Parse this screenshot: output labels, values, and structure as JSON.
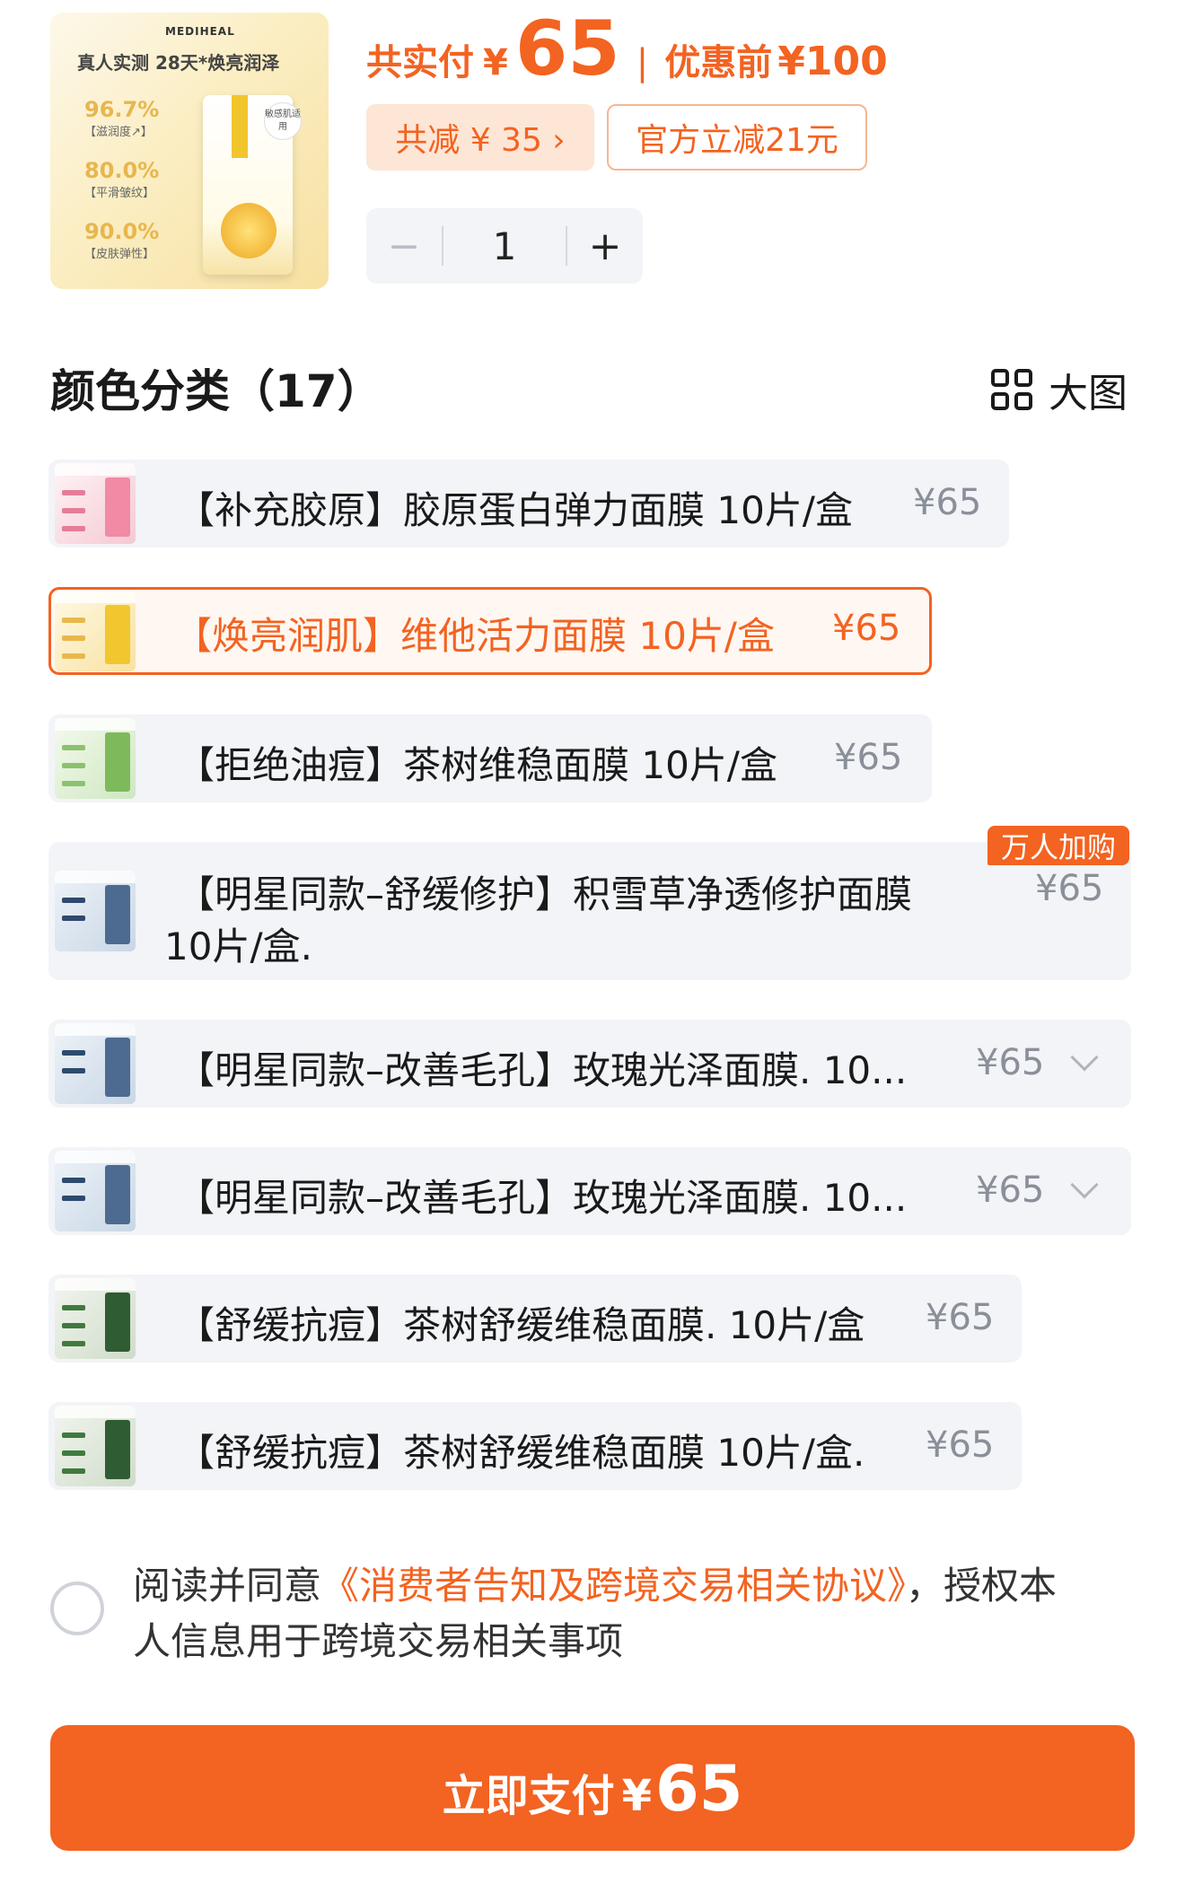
{
  "product": {
    "thumb_brand": "MEDIHEAL",
    "thumb_title": "真人实测  28天*焕亮润泽",
    "thumb_stats": [
      {
        "value": "96.7%",
        "label": "【滋润度↗】"
      },
      {
        "value": "80.0%",
        "label": "【平滑皱纹】"
      },
      {
        "value": "90.0%",
        "label": "【皮肤弹性】"
      }
    ],
    "thumb_badge": "敏感肌适用"
  },
  "price": {
    "total_label": "共实付",
    "currency": "¥",
    "total_value": "65",
    "separator": "|",
    "before_label": "优惠前",
    "before_value": "¥100"
  },
  "discounts": {
    "total_cut": "共减 ¥ 35 ›",
    "official_cut": "官方立减21元"
  },
  "quantity": {
    "minus": "−",
    "value": "1",
    "plus": "+"
  },
  "section": {
    "title": "颜色分类（17）",
    "view_toggle": "大图"
  },
  "options": [
    {
      "name": "【补充胶原】胶原蛋白弹力面膜 10片/盒",
      "price": "¥65"
    },
    {
      "name": "【焕亮润肌】维他活力面膜 10片/盒",
      "price": "¥65"
    },
    {
      "name": "【拒绝油痘】茶树维稳面膜 10片/盒",
      "price": "¥65"
    },
    {
      "name_line1": "【明星同款–舒缓修护】积雪草净透修护面膜",
      "name_line2": "10片/盒.",
      "price": "¥65",
      "badge": "万人加购"
    },
    {
      "name": "【明星同款–改善毛孔】玫瑰光泽面膜. 10...",
      "price": "¥65"
    },
    {
      "name": "【明星同款–改善毛孔】玫瑰光泽面膜. 10...",
      "price": "¥65"
    },
    {
      "name": "【舒缓抗痘】茶树舒缓维稳面膜. 10片/盒",
      "price": "¥65"
    },
    {
      "name": "【舒缓抗痘】茶树舒缓维稳面膜 10片/盒.",
      "price": "¥65"
    }
  ],
  "agreement": {
    "prefix": "阅读并同意",
    "link": "《消费者告知及跨境交易相关协议》",
    "suffix": "，授权本人信息用于跨境交易相关事项"
  },
  "pay": {
    "label": "立即支付",
    "currency": "¥",
    "value": "65"
  },
  "colors": {
    "accent": "#f36321",
    "chip_bg": "#fde6d6",
    "option_bg": "#f2f4f7"
  }
}
